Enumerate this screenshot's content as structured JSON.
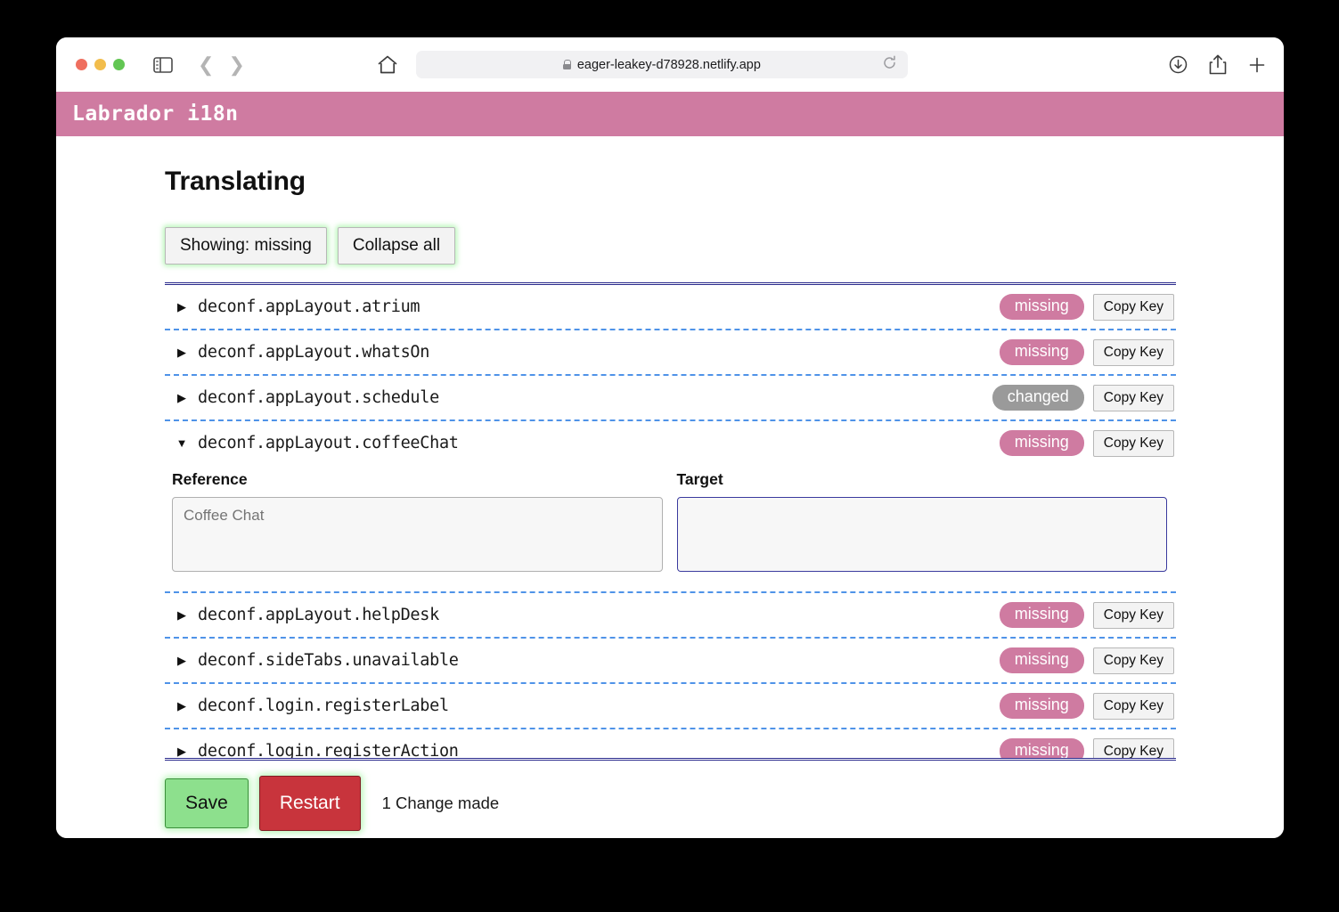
{
  "browser": {
    "url": "eager-leakey-d78928.netlify.app",
    "lock_icon": "lock-icon",
    "home_icon": "home-icon",
    "reload_icon": "reload-icon",
    "sidebar_toggle_icon": "sidebar-toggle-icon",
    "back_icon": "chevron-left-icon",
    "forward_icon": "chevron-right-icon",
    "download_icon": "download-icon",
    "share_icon": "share-icon",
    "newtab_icon": "plus-icon"
  },
  "app": {
    "title": "Labrador i18n",
    "header_color": "#cf7ba1"
  },
  "page": {
    "title": "Translating"
  },
  "toolbar": {
    "showing_label": "Showing: missing",
    "collapse_label": "Collapse all"
  },
  "list": {
    "copy_key_label": "Copy Key",
    "expanded_triangle": "▼",
    "collapsed_triangle": "▶",
    "rows": [
      {
        "key": "deconf.appLayout.atrium",
        "status": "missing",
        "expanded": false
      },
      {
        "key": "deconf.appLayout.whatsOn",
        "status": "missing",
        "expanded": false
      },
      {
        "key": "deconf.appLayout.schedule",
        "status": "changed",
        "expanded": false
      },
      {
        "key": "deconf.appLayout.coffeeChat",
        "status": "missing",
        "expanded": true,
        "editor": {
          "reference_label": "Reference",
          "target_label": "Target",
          "reference_value": "Coffee Chat",
          "target_value": ""
        }
      },
      {
        "key": "deconf.appLayout.helpDesk",
        "status": "missing",
        "expanded": false
      },
      {
        "key": "deconf.sideTabs.unavailable",
        "status": "missing",
        "expanded": false
      },
      {
        "key": "deconf.login.registerLabel",
        "status": "missing",
        "expanded": false
      },
      {
        "key": "deconf.login.registerAction",
        "status": "missing",
        "expanded": false
      }
    ]
  },
  "footer": {
    "save_label": "Save",
    "restart_label": "Restart",
    "change_status": "1 Change made"
  },
  "colors": {
    "accent_pink": "#cf7ba1",
    "badge_changed": "#9a9a9a",
    "save_green": "#8de08d",
    "restart_red": "#c8343c",
    "border_navy": "#2a2a8c",
    "separator_blue": "#4f93e8"
  }
}
